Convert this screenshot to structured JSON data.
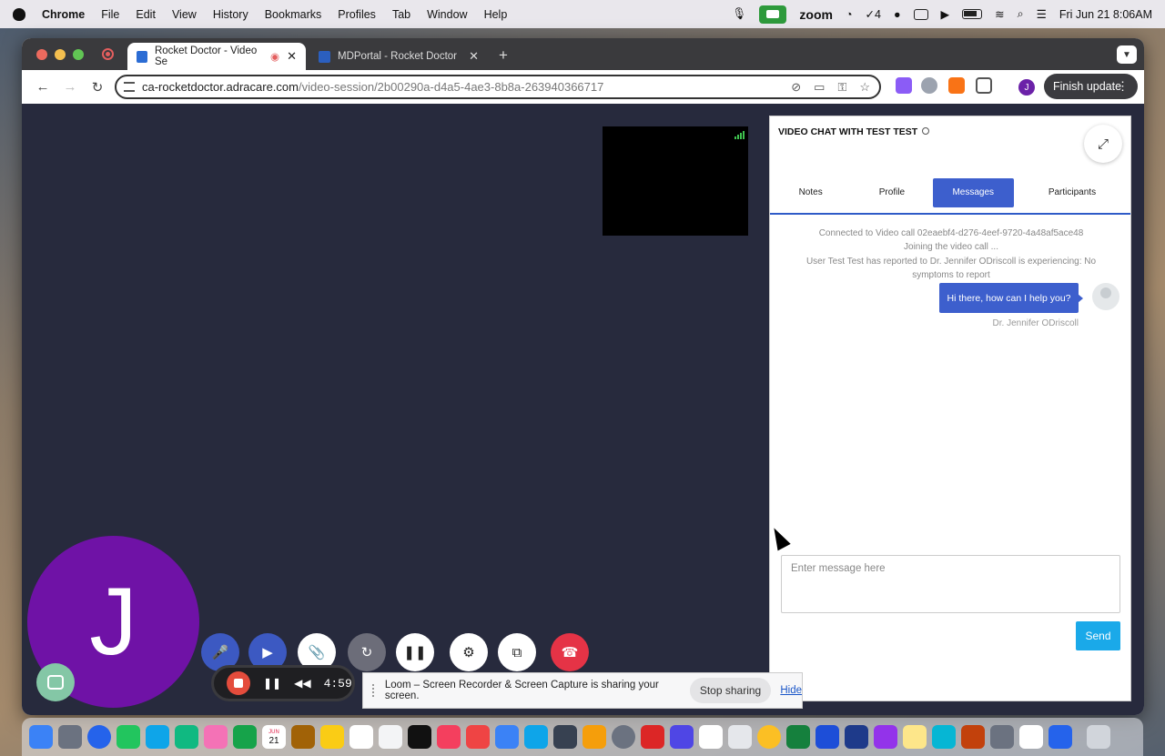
{
  "menubar": {
    "app": "Chrome",
    "items": [
      "File",
      "Edit",
      "View",
      "History",
      "Bookmarks",
      "Profiles",
      "Tab",
      "Window",
      "Help"
    ],
    "zoom_label": "zoom",
    "tasks_count": "4",
    "datetime": "Fri Jun 21  8:06AM"
  },
  "browser": {
    "tabs": [
      {
        "title": "Rocket Doctor - Video Se",
        "active": true
      },
      {
        "title": "MDPortal - Rocket Doctor",
        "active": false
      }
    ],
    "url_host": "ca-rocketdoctor.adracare.com",
    "url_path": "/video-session/2b00290a-d4a5-4ae3-8b8a-263940366717",
    "profile_initial": "J",
    "finish_update": "Finish update"
  },
  "video": {
    "avatar_initial": "J"
  },
  "chat": {
    "title": "VIDEO CHAT WITH TEST TEST",
    "tabs": [
      "Notes",
      "Profile",
      "Messages",
      "Participants"
    ],
    "active_tab": "Messages",
    "system_messages": [
      "Connected to Video call 02eaebf4-d276-4eef-9720-4a48af5ace48",
      "Joining the video call ...",
      "User Test Test has reported to Dr. Jennifer ODriscoll is experiencing: No symptoms to report"
    ],
    "message": {
      "text": "Hi there, how can I help you?",
      "sender": "Dr. Jennifer ODriscoll"
    },
    "input_placeholder": "Enter message here",
    "send_label": "Send"
  },
  "loom": {
    "timer": "4:59",
    "share_text": "Loom – Screen Recorder & Screen Capture is sharing your screen.",
    "stop_sharing": "Stop sharing",
    "hide": "Hide"
  },
  "dock": {
    "calendar_day": "21",
    "calendar_month": "JUN"
  },
  "colors": {
    "video_bg": "#272a3d",
    "accent_blue": "#3d5fcd",
    "send_blue": "#1aa9e9",
    "end_call_red": "#e53346",
    "avatar_purple": "#6f12a6"
  }
}
